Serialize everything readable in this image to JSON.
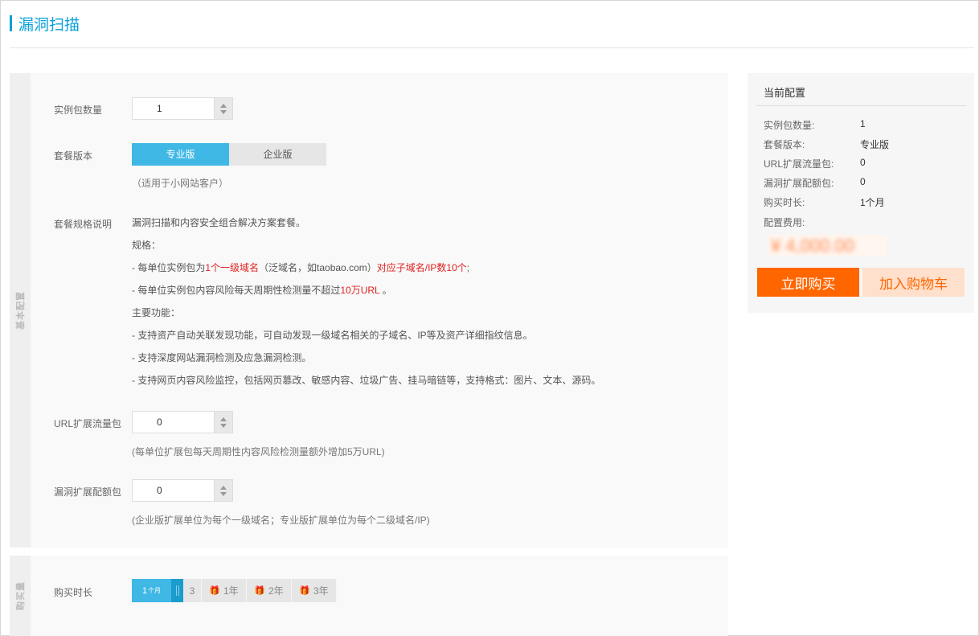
{
  "page_title": "漏洞扫描",
  "basic_section": {
    "tab_label": "基本配置",
    "instance_count": {
      "label": "实例包数量",
      "value": "1"
    },
    "edition": {
      "label": "套餐版本",
      "options": [
        "专业版",
        "企业版"
      ],
      "selected": "专业版",
      "hint": "（适用于小网站客户）"
    },
    "spec": {
      "label": "套餐规格说明",
      "intro": "漏洞扫描和内容安全组合解决方案套餐。",
      "spec_heading": "规格：",
      "line1_prefix": "- 每单位实例包为",
      "line1_red1": "1个一级域名",
      "line1_mid": "（泛域名，如taobao.com）",
      "line1_red2": "对应子域名/IP数10个",
      "line1_suffix": ";",
      "line2_prefix": "- 每单位实例包内容风险每天周期性检测量不超过",
      "line2_red": "10万URL",
      "line2_suffix": " 。",
      "features_heading": "主要功能：",
      "feature1": "- 支持资产自动关联发现功能，可自动发现一级域名相关的子域名、IP等及资产详细指纹信息。",
      "feature2": "- 支持深度网站漏洞检测及应急漏洞检测。",
      "feature3": "- 支持网页内容风险监控，包括网页篡改、敏感内容、垃圾广告、挂马暗链等，支持格式：图片、文本、源码。"
    },
    "url_pack": {
      "label": "URL扩展流量包",
      "value": "0",
      "hint": "(每单位扩展包每天周期性内容风险检测量额外增加5万URL)"
    },
    "vuln_pack": {
      "label": "漏洞扩展配额包",
      "value": "0",
      "hint": "(企业版扩展单位为每个一级域名；专业版扩展单位为每个二级域名/IP)"
    }
  },
  "duration_section": {
    "tab_label": "购买量",
    "label": "购买时长",
    "selected_num": "1",
    "selected_unit": "个月",
    "opt_3": "3",
    "opt_1y": "1年",
    "opt_2y": "2年",
    "opt_3y": "3年",
    "gift_icon": "gift-icon"
  },
  "current_config": {
    "title": "当前配置",
    "rows": [
      {
        "label": "实例包数量:",
        "value": "1"
      },
      {
        "label": "套餐版本:",
        "value": "专业版"
      },
      {
        "label": "URL扩展流量包:",
        "value": "0"
      },
      {
        "label": "漏洞扩展配额包:",
        "value": "0"
      },
      {
        "label": "购买时长:",
        "value": "1个月"
      }
    ],
    "fee_label": "配置费用:",
    "fee_value": "¥ 4,000.00",
    "buy_button": "立即购买",
    "cart_button": "加入购物车"
  },
  "colors": {
    "accent": "#0aa0d8",
    "selected": "#40b8e6",
    "buy": "#ff6600",
    "cart_bg": "#ffe0cc",
    "red_text": "#e02020"
  }
}
